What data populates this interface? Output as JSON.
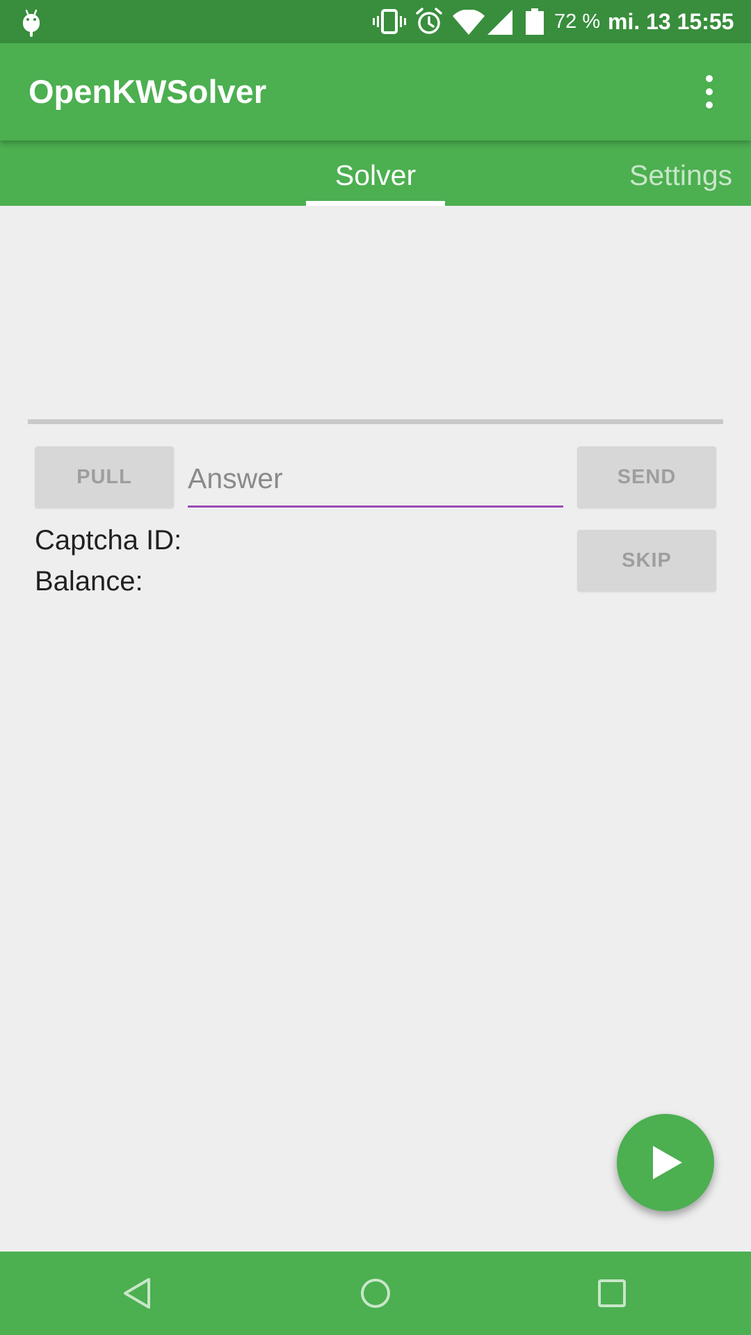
{
  "status_bar": {
    "battery_text": "72 %",
    "clock_text": "mi. 13 15:55",
    "icons": [
      "android-icon",
      "vibrate-icon",
      "alarm-icon",
      "wifi-icon",
      "signal-icon",
      "battery-icon"
    ]
  },
  "app_bar": {
    "title": "OpenKWSolver",
    "menu_icon": "more-vert-icon"
  },
  "tabs": [
    {
      "label": "Solver",
      "selected": true
    },
    {
      "label": "Settings",
      "selected": false
    }
  ],
  "solver": {
    "pull_label": "PULL",
    "answer_placeholder": "Answer",
    "answer_value": "",
    "send_label": "SEND",
    "skip_label": "SKIP",
    "captcha_id_label": "Captcha ID:",
    "balance_label": "Balance:"
  },
  "fab": {
    "icon": "play-icon"
  },
  "nav_bar": {
    "icons": [
      "back-icon",
      "home-icon",
      "recents-icon"
    ]
  },
  "colors": {
    "primary": "#4caf50",
    "primary_dark": "#388e3c",
    "accent_underline": "#9c4ab5",
    "background": "#eeeeef",
    "button_bg": "#d7d7d7",
    "button_text": "#9e9e9e"
  }
}
